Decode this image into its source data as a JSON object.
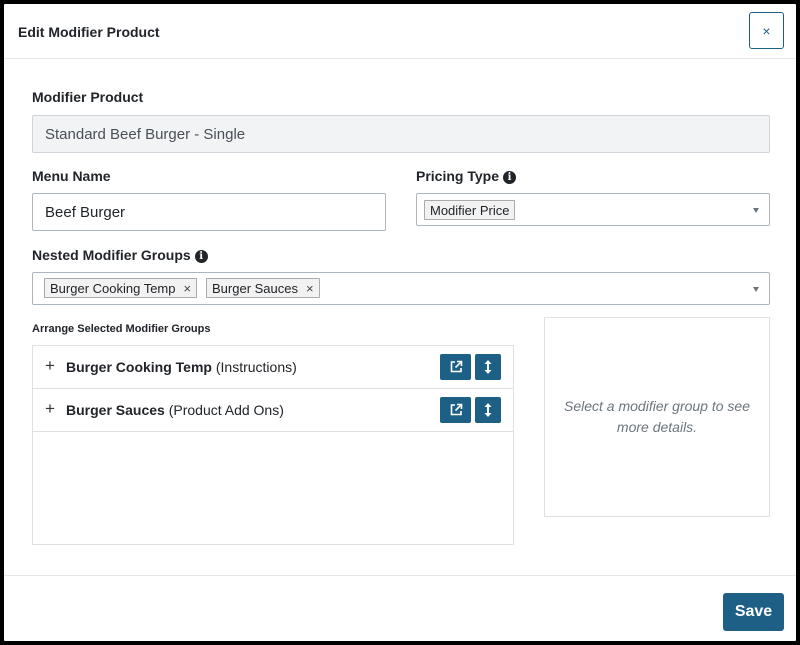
{
  "modal": {
    "title": "Edit Modifier Product",
    "close_label": "×"
  },
  "modifier_product": {
    "label": "Modifier Product",
    "value": "Standard Beef Burger - Single"
  },
  "menu_name": {
    "label": "Menu Name",
    "value": "Beef Burger"
  },
  "pricing_type": {
    "label": "Pricing Type",
    "selected": "Modifier Price"
  },
  "nested_groups": {
    "label": "Nested Modifier Groups",
    "tags": [
      "Burger Cooking Temp",
      "Burger Sauces"
    ],
    "remove_label": "×"
  },
  "arrange": {
    "label": "Arrange Selected Modifier Groups",
    "rows": [
      {
        "name": "Burger Cooking Temp",
        "type": "(Instructions)"
      },
      {
        "name": "Burger Sauces",
        "type": "(Product Add Ons)"
      }
    ],
    "expand_label": "+"
  },
  "details": {
    "placeholder": "Select a modifier group to see more details."
  },
  "footer": {
    "save_label": "Save"
  },
  "icons": {
    "info": "info-circle-icon",
    "open": "external-link-icon",
    "reorder": "arrows-vertical-icon",
    "dropdown": "caret-down-icon"
  },
  "colors": {
    "primary": "#1e5f86",
    "field_readonly_bg": "#f1f3f5",
    "muted_text": "#6c757d"
  }
}
